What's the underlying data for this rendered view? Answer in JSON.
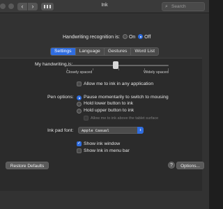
{
  "window": {
    "title": "Ink",
    "search_placeholder": "Search",
    "nav_back": "‹",
    "nav_forward": "›"
  },
  "recognition": {
    "label": "Handwriting recognition is:",
    "options": [
      {
        "label": "On",
        "selected": false
      },
      {
        "label": "Off",
        "selected": true
      }
    ]
  },
  "tabs": [
    {
      "label": "Settings",
      "active": true
    },
    {
      "label": "Language",
      "active": false
    },
    {
      "label": "Gestures",
      "active": false
    },
    {
      "label": "Word List",
      "active": false
    }
  ],
  "settings": {
    "handwriting_label": "My handwriting is:",
    "slider_min_label": "Closely spaced",
    "slider_max_label": "Widely spaced",
    "slider_value": 0.48,
    "allow_any_app": {
      "label": "Allow me to ink in any application",
      "checked": false
    },
    "pen_options_label": "Pen options:",
    "pen_options": [
      {
        "label": "Pause momentarily to switch to mousing",
        "selected": true
      },
      {
        "label": "Hold lower button to ink",
        "selected": false
      },
      {
        "label": "Hold upper button to ink",
        "selected": false
      }
    ],
    "allow_above_tablet": {
      "label": "Allow me to ink above the tablet surface",
      "checked": false,
      "disabled": true
    },
    "ink_pad_font_label": "Ink pad font:",
    "ink_pad_font_value": "Apple Casual",
    "show_ink_window": {
      "label": "Show ink window",
      "checked": true
    },
    "show_ink_menu_bar": {
      "label": "Show Ink in menu bar",
      "checked": false
    }
  },
  "footer": {
    "restore_label": "Restore Defaults",
    "options_label": "Options...",
    "help_label": "?"
  },
  "colors": {
    "accent": "#2f6de0",
    "background": "#323232"
  }
}
